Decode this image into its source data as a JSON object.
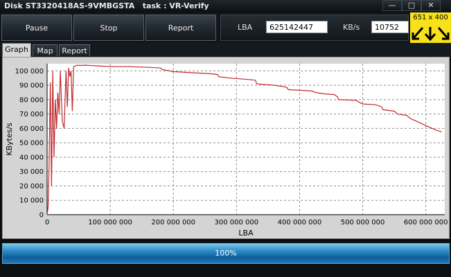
{
  "window": {
    "title": "Disk ST3320418AS-9VMBGSTA   task : VR-Verify",
    "buttons": {
      "minimize": "—",
      "maximize": "□",
      "close": "✕"
    }
  },
  "toolbar": {
    "pause_label": "Pause",
    "stop_label": "Stop",
    "report_label": "Report",
    "lba_label": "LBA",
    "lba_value": "625142447",
    "kbs_label": "KB/s",
    "kbs_value": "10752"
  },
  "overlay": {
    "size_text": "651 x 400"
  },
  "tabs": [
    {
      "label": "Graph",
      "active": true
    },
    {
      "label": "Map",
      "active": false
    },
    {
      "label": "Report",
      "active": false
    }
  ],
  "progress": {
    "percent": 100,
    "label": "100%"
  },
  "chart_data": {
    "type": "line",
    "xlabel": "LBA",
    "ylabel": "KBytes/s",
    "xlim": [
      0,
      630000000
    ],
    "ylim": [
      0,
      105000
    ],
    "x_ticks": [
      0,
      100000000,
      200000000,
      300000000,
      400000000,
      500000000,
      600000000
    ],
    "x_tick_labels": [
      "0",
      "100 000 000",
      "200 000 000",
      "300 000 000",
      "400 000 000",
      "500 000 000",
      "600 000 000"
    ],
    "y_ticks": [
      0,
      10000,
      20000,
      30000,
      40000,
      50000,
      60000,
      70000,
      80000,
      90000,
      100000
    ],
    "y_tick_labels": [
      "0",
      "10 000",
      "20 000",
      "30 000",
      "40 000",
      "50 000",
      "60 000",
      "70 000",
      "80 000",
      "90 000",
      "100 000"
    ],
    "grid": true,
    "line_color": "#c0282d",
    "series": [
      {
        "x": [
          0,
          1500000,
          3000000,
          5000000,
          7000000,
          9000000,
          11000000,
          13000000,
          15000000,
          17000000,
          19000000,
          21000000,
          24000000,
          27000000,
          30000000,
          32000000,
          34000000,
          36000000,
          38000000,
          40000000,
          42000000,
          45000000,
          48000000,
          52000000,
          60000000,
          80000000,
          100000000,
          130000000,
          160000000,
          180000000,
          182000000,
          200000000,
          220000000,
          240000000,
          260000000,
          270000000,
          272000000,
          290000000,
          305000000,
          320000000,
          330000000,
          332000000,
          360000000,
          375000000,
          380000000,
          382000000,
          400000000,
          420000000,
          425000000,
          440000000,
          455000000,
          460000000,
          462000000,
          490000000,
          495000000,
          500000000,
          520000000,
          530000000,
          532000000,
          550000000,
          555000000,
          570000000,
          575000000,
          590000000,
          600000000,
          610000000,
          615000000,
          622000000,
          625000000
        ],
        "y": [
          0,
          5000,
          30000,
          92000,
          20000,
          100000,
          40000,
          80000,
          60000,
          85000,
          70000,
          100000,
          65000,
          60000,
          100000,
          75000,
          102000,
          96000,
          100000,
          72000,
          103000,
          103500,
          104000,
          103800,
          104000,
          103500,
          103000,
          103000,
          102500,
          102000,
          101000,
          99500,
          99000,
          98500,
          98000,
          97500,
          96000,
          95000,
          94500,
          94000,
          93500,
          91000,
          90000,
          89000,
          88500,
          87000,
          86500,
          86000,
          85000,
          84000,
          83500,
          82000,
          80000,
          79500,
          78000,
          77000,
          76500,
          75000,
          73000,
          72000,
          70000,
          69000,
          67000,
          64000,
          62000,
          60000,
          59000,
          58000,
          57500
        ]
      }
    ]
  }
}
